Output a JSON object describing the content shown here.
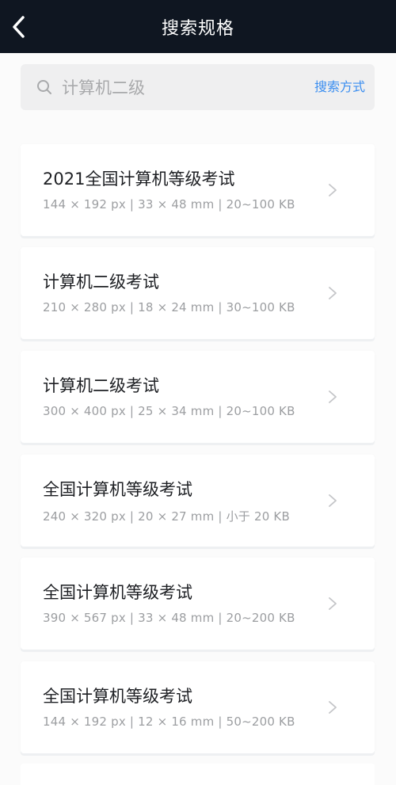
{
  "header": {
    "title": "搜索规格",
    "back_icon": "chevron-left-icon"
  },
  "search": {
    "query": "计算机二级",
    "mode_label": "搜索方式",
    "icon": "search-icon"
  },
  "colors": {
    "navbar_bg": "#0f1621",
    "accent": "#3b8ef0",
    "page_bg": "#fbfbfb"
  },
  "results": [
    {
      "title": "2021全国计算机等级考试",
      "meta": "144 × 192 px | 33 × 48 mm | 20~100 KB"
    },
    {
      "title": "计算机二级考试",
      "meta": "210 × 280 px | 18 × 24 mm | 30~100 KB"
    },
    {
      "title": "计算机二级考试",
      "meta": "300 × 400 px | 25 × 34 mm | 20~100 KB"
    },
    {
      "title": "全国计算机等级考试",
      "meta": "240 × 320 px | 20 × 27 mm | 小于 20 KB"
    },
    {
      "title": "全国计算机等级考试",
      "meta": "390 × 567 px | 33 × 48 mm | 20~200 KB"
    },
    {
      "title": "全国计算机等级考试",
      "meta": "144 × 192 px | 12 × 16 mm | 50~200 KB"
    }
  ]
}
